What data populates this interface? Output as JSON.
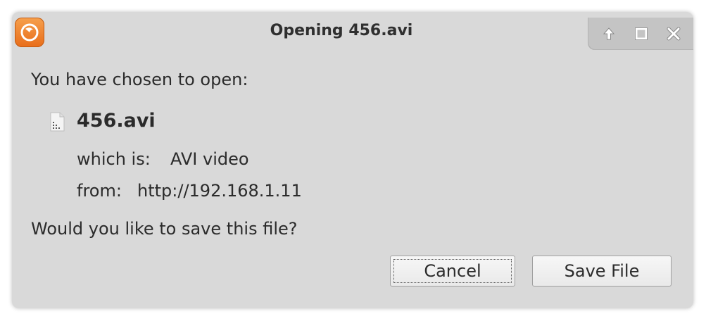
{
  "window": {
    "title": "Opening 456.avi",
    "app_icon": "firefox-icon",
    "controls": [
      "up-arrow-icon",
      "maximize-icon",
      "close-icon"
    ]
  },
  "prompt": "You have chosen to open:",
  "file": {
    "icon": "video-file-icon",
    "name": "456.avi",
    "type_label": "which is:",
    "type_value": "AVI video",
    "from_label": "from:",
    "from_value": "http://192.168.1.11"
  },
  "question": "Would you like to save this file?",
  "buttons": {
    "cancel": "Cancel",
    "save": "Save File"
  },
  "colors": {
    "dialog_bg": "#d9d9d9",
    "accent": "#e86d1a"
  }
}
